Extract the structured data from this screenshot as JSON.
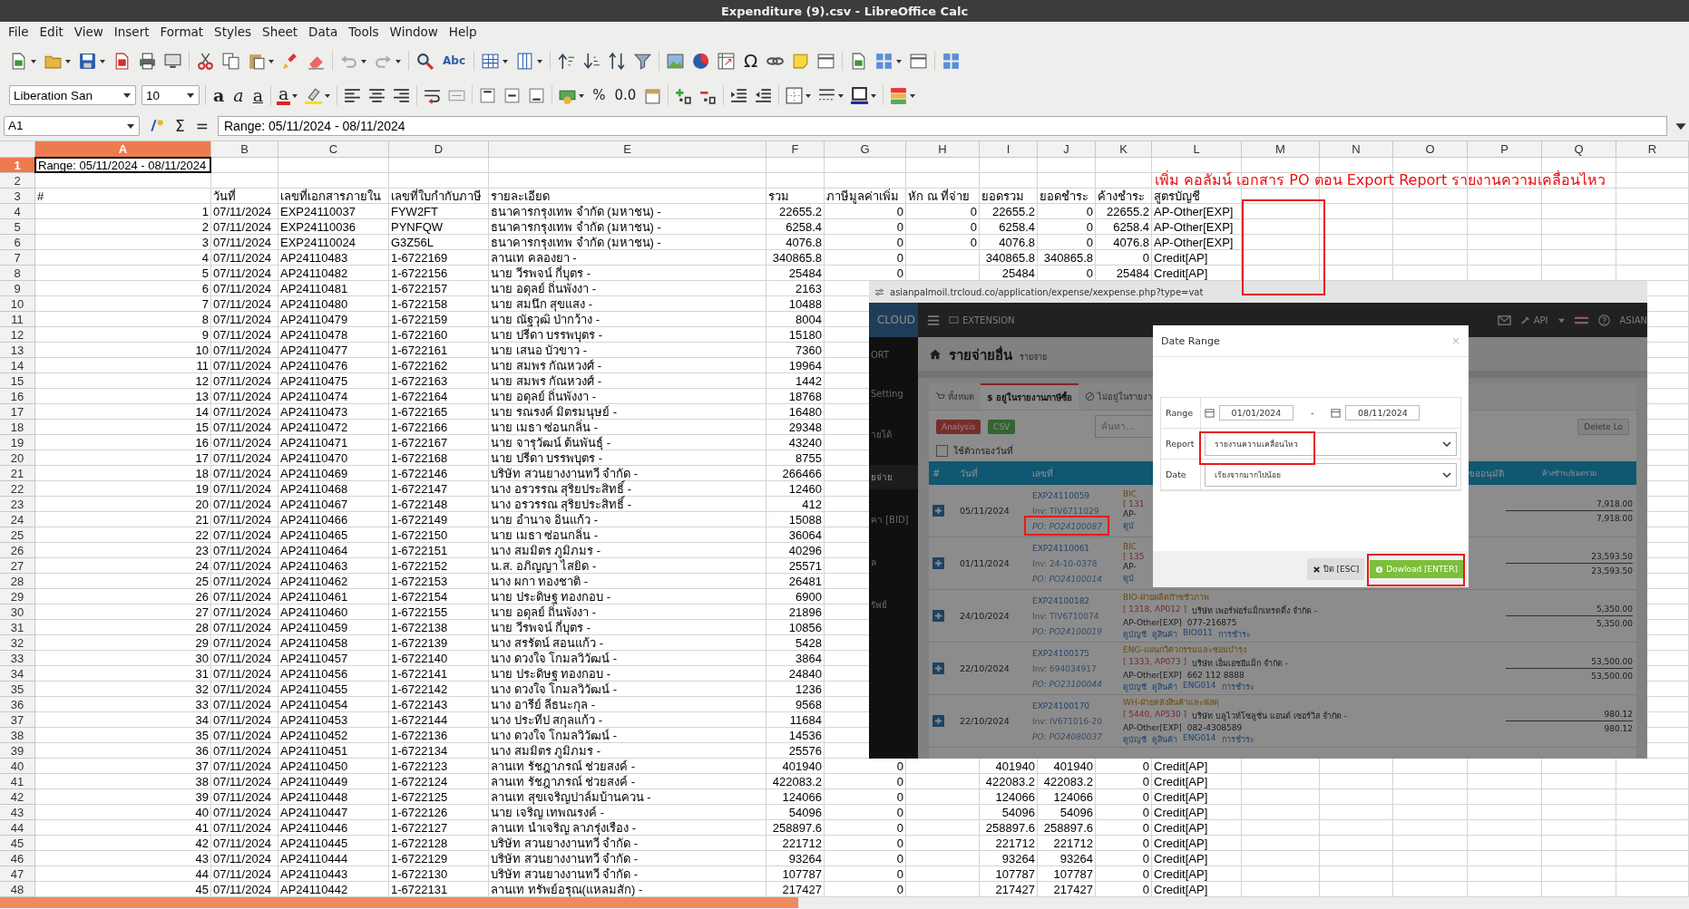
{
  "window": {
    "title": "Expenditure (9).csv - LibreOffice Calc"
  },
  "menu": [
    "File",
    "Edit",
    "View",
    "Insert",
    "Format",
    "Styles",
    "Sheet",
    "Data",
    "Tools",
    "Window",
    "Help"
  ],
  "toolbar": {
    "glyphs": [
      "Abc",
      "Ω"
    ],
    "font_name": "Liberation San",
    "font_size": "10",
    "format_glyphs": [
      "a",
      "a",
      "a",
      "a",
      "%",
      "0.0"
    ]
  },
  "formula_bar": {
    "cell": "A1",
    "symbols": [
      "Σ",
      "="
    ],
    "content": "Range: 05/11/2024 - 08/11/2024"
  },
  "sheet": {
    "columns": [
      {
        "label": "A",
        "selected": true
      },
      {
        "label": "B",
        "selected": false
      },
      {
        "label": "C",
        "selected": false
      },
      {
        "label": "D",
        "selected": false
      },
      {
        "label": "E",
        "selected": false
      },
      {
        "label": "F",
        "selected": false
      },
      {
        "label": "G",
        "selected": false
      },
      {
        "label": "H",
        "selected": false
      },
      {
        "label": "I",
        "selected": false
      },
      {
        "label": "J",
        "selected": false
      },
      {
        "label": "K",
        "selected": false
      },
      {
        "label": "L",
        "selected": false
      },
      {
        "label": "M",
        "selected": false
      },
      {
        "label": "N",
        "selected": false
      },
      {
        "label": "O",
        "selected": false
      },
      {
        "label": "P",
        "selected": false
      },
      {
        "label": "Q",
        "selected": false
      },
      {
        "label": "R",
        "selected": false
      }
    ],
    "rows": [
      {
        "number": "1",
        "selected": true,
        "kind": "text",
        "cells": [
          "Range: 05/11/2024 - 08/11/2024"
        ]
      },
      {
        "number": "2",
        "selected": false,
        "cells": []
      },
      {
        "number": "3",
        "selected": false,
        "kind": "text",
        "cells": [
          "#",
          "วันที่",
          "เลขที่เอกสารภายใน",
          "เลขที่ใบกำกับภาษี",
          "รายละเอียด",
          "รวม",
          "ภาษีมูลค่าเพิ่ม",
          "หัก ณ ที่จ่าย",
          "ยอดรวม",
          "ยอดชำระ",
          "ค้างชำระ",
          "สูตรบัญชี"
        ]
      },
      {
        "number": "4",
        "selected": false,
        "kind": "record",
        "cells": [
          "1",
          "07/11/2024",
          "EXP24110037",
          "FYW2FT",
          "ธนาคารกรุงเทพ จำกัด (มหาชน) -",
          "22655.2",
          "0",
          "0",
          "22655.2",
          "0",
          "22655.2",
          "AP-Other[EXP]"
        ]
      },
      {
        "number": "5",
        "selected": false,
        "kind": "record",
        "cells": [
          "2",
          "07/11/2024",
          "EXP24110036",
          "PYNFQW",
          "ธนาคารกรุงเทพ จำกัด (มหาชน) -",
          "6258.4",
          "0",
          "0",
          "6258.4",
          "0",
          "6258.4",
          "AP-Other[EXP]"
        ]
      },
      {
        "number": "6",
        "selected": false,
        "kind": "record",
        "cells": [
          "3",
          "07/11/2024",
          "EXP24110024",
          "G3Z56L",
          "ธนาคารกรุงเทพ จำกัด (มหาชน) -",
          "4076.8",
          "0",
          "0",
          "4076.8",
          "0",
          "4076.8",
          "AP-Other[EXP]"
        ]
      },
      {
        "number": "7",
        "selected": false,
        "kind": "record",
        "cells": [
          "4",
          "07/11/2024",
          "AP24110483",
          "1-6722169",
          "ลานเท คลองยา -",
          "340865.8",
          "0",
          null,
          "340865.8",
          "340865.8",
          "0",
          "Credit[AP]"
        ]
      },
      {
        "number": "8",
        "selected": false,
        "kind": "record",
        "cells": [
          "5",
          "07/11/2024",
          "AP24110482",
          "1-6722156",
          "นาย วีรพจน์ กี่บุตร -",
          "25484",
          "0",
          null,
          "25484",
          "0",
          "25484",
          "Credit[AP]"
        ]
      },
      {
        "number": "9",
        "selected": false,
        "kind": "record",
        "cells": [
          "6",
          "07/11/2024",
          "AP24110481",
          "1-6722157",
          "นาย อดุลย์ ถิ่นพังงา -",
          "2163"
        ]
      },
      {
        "number": "10",
        "selected": false,
        "kind": "record",
        "cells": [
          "7",
          "07/11/2024",
          "AP24110480",
          "1-6722158",
          "นาย สมนึก สุขแสง -",
          "10488"
        ]
      },
      {
        "number": "11",
        "selected": false,
        "kind": "record",
        "cells": [
          "8",
          "07/11/2024",
          "AP24110479",
          "1-6722159",
          "นาย ณัฐวุฒิ ป่ากว้าง -",
          "8004"
        ]
      },
      {
        "number": "12",
        "selected": false,
        "kind": "record",
        "cells": [
          "9",
          "07/11/2024",
          "AP24110478",
          "1-6722160",
          "นาย ปรีดา บรรพบุตร -",
          "15180"
        ]
      },
      {
        "number": "13",
        "selected": false,
        "kind": "record",
        "cells": [
          "10",
          "07/11/2024",
          "AP24110477",
          "1-6722161",
          "นาย เสนอ บัวขาว -",
          "7360"
        ]
      },
      {
        "number": "14",
        "selected": false,
        "kind": "record",
        "cells": [
          "11",
          "07/11/2024",
          "AP24110476",
          "1-6722162",
          "นาย สมพร กัณหวงศ์ -",
          "19964"
        ]
      },
      {
        "number": "15",
        "selected": false,
        "kind": "record",
        "cells": [
          "12",
          "07/11/2024",
          "AP24110475",
          "1-6722163",
          "นาย สมพร กัณหวงศ์ -",
          "1442"
        ]
      },
      {
        "number": "16",
        "selected": false,
        "kind": "record",
        "cells": [
          "13",
          "07/11/2024",
          "AP24110474",
          "1-6722164",
          "นาย อดุลย์ ถิ่นพังงา -",
          "18768"
        ]
      },
      {
        "number": "17",
        "selected": false,
        "kind": "record",
        "cells": [
          "14",
          "07/11/2024",
          "AP24110473",
          "1-6722165",
          "นาย รณรงค์ มิตรมนุษย์ -",
          "16480"
        ]
      },
      {
        "number": "18",
        "selected": false,
        "kind": "record",
        "cells": [
          "15",
          "07/11/2024",
          "AP24110472",
          "1-6722166",
          "นาย เมธา ซ่อนกลิ่น -",
          "29348"
        ]
      },
      {
        "number": "19",
        "selected": false,
        "kind": "record",
        "cells": [
          "16",
          "07/11/2024",
          "AP24110471",
          "1-6722167",
          "นาย จารุวัฒน์ ต้นพันธุ์ -",
          "43240"
        ]
      },
      {
        "number": "20",
        "selected": false,
        "kind": "record",
        "cells": [
          "17",
          "07/11/2024",
          "AP24110470",
          "1-6722168",
          "นาย ปรีดา บรรพบุตร -",
          "8755"
        ]
      },
      {
        "number": "21",
        "selected": false,
        "kind": "record",
        "cells": [
          "18",
          "07/11/2024",
          "AP24110469",
          "1-6722146",
          "บริษัท สวนยางงานทวี จำกัด -",
          "266466"
        ]
      },
      {
        "number": "22",
        "selected": false,
        "kind": "record",
        "cells": [
          "19",
          "07/11/2024",
          "AP24110468",
          "1-6722147",
          "นาง อรวรรณ สุริยประสิทธิ์ -",
          "12460"
        ]
      },
      {
        "number": "23",
        "selected": false,
        "kind": "record",
        "cells": [
          "20",
          "07/11/2024",
          "AP24110467",
          "1-6722148",
          "นาง อรวรรณ สุริยประสิทธิ์ -",
          "412"
        ]
      },
      {
        "number": "24",
        "selected": false,
        "kind": "record",
        "cells": [
          "21",
          "07/11/2024",
          "AP24110466",
          "1-6722149",
          "นาย อำนาจ อินแก้ว -",
          "15088"
        ]
      },
      {
        "number": "25",
        "selected": false,
        "kind": "record",
        "cells": [
          "22",
          "07/11/2024",
          "AP24110465",
          "1-6722150",
          "นาย เมธา ซ่อนกลิ่น -",
          "36064"
        ]
      },
      {
        "number": "26",
        "selected": false,
        "kind": "record",
        "cells": [
          "23",
          "07/11/2024",
          "AP24110464",
          "1-6722151",
          "นาง สมมิตร ภูมิภมร -",
          "40296"
        ]
      },
      {
        "number": "27",
        "selected": false,
        "kind": "record",
        "cells": [
          "24",
          "07/11/2024",
          "AP24110463",
          "1-6722152",
          "น.ส. อภิญญา ไสยิด -",
          "25571"
        ]
      },
      {
        "number": "28",
        "selected": false,
        "kind": "record",
        "cells": [
          "25",
          "07/11/2024",
          "AP24110462",
          "1-6722153",
          "นาง ผกา ทองชาติ -",
          "26481"
        ]
      },
      {
        "number": "29",
        "selected": false,
        "kind": "record",
        "cells": [
          "26",
          "07/11/2024",
          "AP24110461",
          "1-6722154",
          "นาย ประดิษฐ ทองกอบ -",
          "6900"
        ]
      },
      {
        "number": "30",
        "selected": false,
        "kind": "record",
        "cells": [
          "27",
          "07/11/2024",
          "AP24110460",
          "1-6722155",
          "นาย อดุลย์ ถิ่นพังงา -",
          "21896"
        ]
      },
      {
        "number": "31",
        "selected": false,
        "kind": "record",
        "cells": [
          "28",
          "07/11/2024",
          "AP24110459",
          "1-6722138",
          "นาย วีรพจน์ กี่บุตร -",
          "10856"
        ]
      },
      {
        "number": "32",
        "selected": false,
        "kind": "record",
        "cells": [
          "29",
          "07/11/2024",
          "AP24110458",
          "1-6722139",
          "นาง สรรัตน์ สอนแก้ว -",
          "5428"
        ]
      },
      {
        "number": "33",
        "selected": false,
        "kind": "record",
        "cells": [
          "30",
          "07/11/2024",
          "AP24110457",
          "1-6722140",
          "นาง ดวงใจ โกมลวิวัฒน์ -",
          "3864"
        ]
      },
      {
        "number": "34",
        "selected": false,
        "kind": "record",
        "cells": [
          "31",
          "07/11/2024",
          "AP24110456",
          "1-6722141",
          "นาย ประดิษฐ ทองกอบ -",
          "24840"
        ]
      },
      {
        "number": "35",
        "selected": false,
        "kind": "record",
        "cells": [
          "32",
          "07/11/2024",
          "AP24110455",
          "1-6722142",
          "นาง ดวงใจ โกมลวิวัฒน์ -",
          "1236"
        ]
      },
      {
        "number": "36",
        "selected": false,
        "kind": "record",
        "cells": [
          "33",
          "07/11/2024",
          "AP24110454",
          "1-6722143",
          "นาง อารีย์ ลีธนะกุล -",
          "9568"
        ]
      },
      {
        "number": "37",
        "selected": false,
        "kind": "record",
        "cells": [
          "34",
          "07/11/2024",
          "AP24110453",
          "1-6722144",
          "นาง ประทีป สกุลแก้ว -",
          "11684"
        ]
      },
      {
        "number": "38",
        "selected": false,
        "kind": "record",
        "cells": [
          "35",
          "07/11/2024",
          "AP24110452",
          "1-6722136",
          "นาง ดวงใจ โกมลวิวัฒน์ -",
          "14536"
        ]
      },
      {
        "number": "39",
        "selected": false,
        "kind": "record",
        "cells": [
          "36",
          "07/11/2024",
          "AP24110451",
          "1-6722134",
          "นาง สมมิตร ภูมิภมร -",
          "25576"
        ]
      },
      {
        "number": "40",
        "selected": false,
        "kind": "record",
        "cells": [
          "37",
          "07/11/2024",
          "AP24110450",
          "1-6722123",
          "ลานเท รัชฎาภรณ์ ช่วยสงค์ -",
          "401940",
          "0",
          null,
          "401940",
          "401940",
          "0",
          "Credit[AP]"
        ]
      },
      {
        "number": "41",
        "selected": false,
        "kind": "record",
        "cells": [
          "38",
          "07/11/2024",
          "AP24110449",
          "1-6722124",
          "ลานเท รัชฎาภรณ์ ช่วยสงค์ -",
          "422083.2",
          "0",
          null,
          "422083.2",
          "422083.2",
          "0",
          "Credit[AP]"
        ]
      },
      {
        "number": "42",
        "selected": false,
        "kind": "record",
        "cells": [
          "39",
          "07/11/2024",
          "AP24110448",
          "1-6722125",
          "ลานเท สุขเจริญปาล์มบ้านควน -",
          "124066",
          "0",
          null,
          "124066",
          "124066",
          "0",
          "Credit[AP]"
        ]
      },
      {
        "number": "43",
        "selected": false,
        "kind": "record",
        "cells": [
          "40",
          "07/11/2024",
          "AP24110447",
          "1-6722126",
          "นาย เจริญ เทพณรงค์ -",
          "54096",
          "0",
          null,
          "54096",
          "54096",
          "0",
          "Credit[AP]"
        ]
      },
      {
        "number": "44",
        "selected": false,
        "kind": "record",
        "cells": [
          "41",
          "07/11/2024",
          "AP24110446",
          "1-6722127",
          "ลานเท นำเจริญ ลาภรุ่งเรือง -",
          "258897.6",
          "0",
          null,
          "258897.6",
          "258897.6",
          "0",
          "Credit[AP]"
        ]
      },
      {
        "number": "45",
        "selected": false,
        "kind": "record",
        "cells": [
          "42",
          "07/11/2024",
          "AP24110445",
          "1-6722128",
          "บริษัท สวนยางงานทวี จำกัด -",
          "221712",
          "0",
          null,
          "221712",
          "221712",
          "0",
          "Credit[AP]"
        ]
      },
      {
        "number": "46",
        "selected": false,
        "kind": "record",
        "cells": [
          "43",
          "07/11/2024",
          "AP24110444",
          "1-6722129",
          "บริษัท สวนยางงานทวี จำกัด -",
          "93264",
          "0",
          null,
          "93264",
          "93264",
          "0",
          "Credit[AP]"
        ]
      },
      {
        "number": "47",
        "selected": false,
        "kind": "record",
        "cells": [
          "44",
          "07/11/2024",
          "AP24110443",
          "1-6722130",
          "บริษัท สวนยางงานทวี จำกัด -",
          "107787",
          "0",
          null,
          "107787",
          "107787",
          "0",
          "Credit[AP]"
        ]
      },
      {
        "number": "48",
        "selected": false,
        "kind": "record",
        "cells": [
          "45",
          "07/11/2024",
          "AP24110442",
          "1-6722131",
          "ลานเท ทรัพย์อรุณ(แหลมสัก) -",
          "217427",
          "0",
          null,
          "217427",
          "217427",
          "0",
          "Credit[AP]"
        ]
      }
    ]
  },
  "annotation": {
    "text": "เพิ่ม คอลัมน์ เอกสาร PO ตอน Export Report รายงานความเคลื่อนไหว"
  },
  "capture": {
    "url": "asianpalmoil.trcloud.co/application/expense/xexpense.php?type=vat",
    "nav": {
      "logo": "CLOUD",
      "extension": "EXTENSION",
      "api": "API",
      "user": "ASIAN"
    },
    "sidebar": [
      {
        "label": "ORT",
        "selected": false
      },
      {
        "label": "Setting",
        "selected": false
      },
      {
        "label": "ายได้",
        "selected": false
      },
      {
        "label": "ยจ่าย",
        "selected": true
      },
      {
        "label": "คา [BID]",
        "selected": false
      },
      {
        "label": "ล",
        "selected": false
      },
      {
        "label": "รัพย์",
        "selected": false
      }
    ],
    "page_title": "รายจ่ายอื่น",
    "page_subtitle": "รายจ่าย",
    "tabs": [
      {
        "label": "ทั้งหมด",
        "selected": false
      },
      {
        "label": "$ อยู่ในรายงานภาษีซื้อ",
        "selected": true
      },
      {
        "label": "ไม่อยู่ในรายงา",
        "selected": false
      }
    ],
    "buttons": [
      "Analysis",
      "CSV"
    ],
    "search_placeholder": "ค้นหา...",
    "delete_label": "Delete Lo",
    "date_filter": {
      "label": "ใช้ตัวกรองวันที่",
      "checked": false
    },
    "columns": [
      "#",
      "วันที่",
      "เลขที่",
      "ขออนุมัติ",
      "ค้างชำระ/ยอดรวม"
    ],
    "rows": [
      {
        "date": "05/11/2024",
        "doc_no": "EXP24110059",
        "invoice": "Inv: TIV6711029",
        "po": "PO: PO24100087",
        "department": "BIC",
        "codes": "[ 131",
        "account": "AP-",
        "links": [
          "ดูบั"
        ],
        "outstanding": "7,918.00",
        "total": "7,918.00"
      },
      {
        "date": "01/11/2024",
        "doc_no": "EXP24110061",
        "invoice": "Inv: 24-10-0378",
        "po": "PO: PO24100014",
        "department": "BIC",
        "codes": "[ 135",
        "account": "AP-",
        "links": [
          "ดูบั"
        ],
        "outstanding": "23,593.50",
        "total": "23,593.50"
      },
      {
        "date": "24/10/2024",
        "doc_no": "EXP24100182",
        "invoice": "Inv: TIV6710074",
        "po": "PO: PO24100019",
        "department": "BIO-ฝ่ายผลิตก๊าซชีวภาพ",
        "codes": "[ 1318, AP012 ]",
        "vendor": "บริษัท เพอร์ฟอร์แม็กเทรดดิ้ง จำกัด -",
        "account": "AP-Other[EXP]",
        "phone": "077-216875",
        "links": [
          "ดูบัญชี",
          "ดูสินค้า",
          "BIO011",
          "การชำระ"
        ],
        "outstanding": "5,350.00",
        "total": "5,350.00"
      },
      {
        "date": "22/10/2024",
        "doc_no": "EXP24100175",
        "invoice": "Inv: 694034917",
        "po": "PO: PO23100044",
        "department": "ENG-แผนกวิศวกรรมและซ่อมบำรุง",
        "codes": "[ 1333, AP073 ]",
        "vendor": "บริษัท เอ็มเอชอีแม็ก จำกัด -",
        "account": "AP-Other[EXP]",
        "phone": "662 112 8888",
        "links": [
          "ดูบัญชี",
          "ดูสินค้า",
          "ENG014",
          "การชำระ"
        ],
        "outstanding": "53,500.00",
        "total": "53,500.00"
      },
      {
        "date": "22/10/2024",
        "doc_no": "EXP24100170",
        "invoice": "Inv: IV671016-20",
        "po": "PO: PO24080037",
        "department": "WH-ฝ่ายคลังสินค้าและพัสดุ",
        "codes": "[ 5440, AP530 ]",
        "vendor": "บริษัท บลูไวท์โซลูชั่น แอนด์ เซอร์วิส จำกัด -",
        "account": "AP-Other[EXP]",
        "phone": "082-4308589",
        "links": [
          "ดูบัญชี",
          "ดูสินค้า",
          "ENG014",
          "การชำระ"
        ],
        "outstanding": "980.12",
        "total": "980.12"
      }
    ],
    "modal": {
      "title": "Date Range",
      "close": "×",
      "fields": [
        {
          "label": "Range",
          "kind": "range",
          "from": "01/01/2024",
          "separator": "-",
          "to": "08/11/2024"
        },
        {
          "label": "Report",
          "kind": "select",
          "value": "รายงานความเคลื่อนไหว"
        },
        {
          "label": "Date",
          "kind": "select",
          "value": "เรียงจากมากไปน้อย"
        }
      ],
      "buttons": [
        {
          "label": "ปิด [ESC]",
          "kind": "close"
        },
        {
          "label": "Dowload [ENTER]",
          "kind": "download"
        }
      ]
    }
  }
}
